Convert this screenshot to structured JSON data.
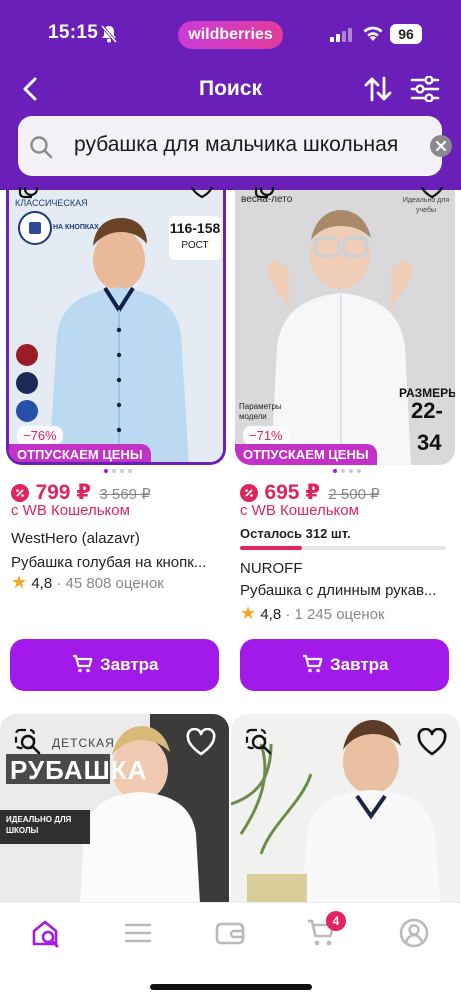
{
  "status": {
    "time": "15:15",
    "brand": "wildberries",
    "battery": "96"
  },
  "nav": {
    "title": "Поиск"
  },
  "search": {
    "query": "рубашка для мальчика школьная"
  },
  "products": [
    {
      "discount": "−76%",
      "tag": "ОТПУСКАЕМ ЦЕНЫ",
      "price": "799 ₽",
      "old_price": "3 569 ₽",
      "wallet": "с WB Кошельком",
      "brand": "WestHero (alazavr)",
      "name": "Рубашка голубая на кнопк...",
      "rating": "4,8",
      "reviews": "· 45 808 оценок",
      "button": "Завтра",
      "image_texts": {
        "type": "КЛАССИЧЕСКАЯ",
        "feature": "НА КНОПКАХ",
        "size": "116-158",
        "size_label": "РОСТ"
      }
    },
    {
      "discount": "−71%",
      "tag": "ОТПУСКАЕМ ЦЕНЫ",
      "price": "695 ₽",
      "old_price": "2 500 ₽",
      "wallet": "с WB Кошельком",
      "stock": "Осталось 312 шт.",
      "stock_fraction": 0.3,
      "brand": "NUROFF",
      "name": "Рубашка с длинным рукав...",
      "rating": "4,8",
      "reviews": "· 1 245 оценок",
      "button": "Завтра",
      "image_texts": {
        "top": "весна-лето",
        "ideal": "Идеально для учебы",
        "params": "Параметры модели",
        "sizes": "РАЗМЕРЫ",
        "range1": "22-",
        "range2": "34"
      }
    },
    {
      "image_texts": {
        "kind": "ДЕТСКАЯ",
        "title": "РУБАШКА",
        "sub": "ИДЕАЛЬНО ДЛЯ ШКОЛЫ"
      }
    },
    {}
  ],
  "tabbar": {
    "cart_count": "4"
  }
}
